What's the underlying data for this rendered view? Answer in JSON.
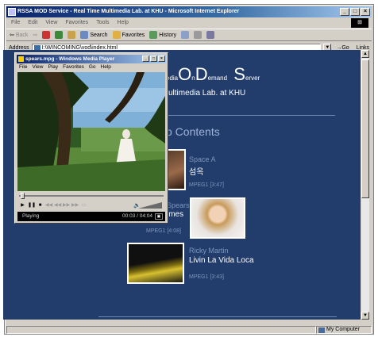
{
  "ie": {
    "title": "RSSA MOD Service - Real Time Multimedia Lab. at KHU - Microsoft Internet Explorer",
    "menu": [
      "File",
      "Edit",
      "View",
      "Favorites",
      "Tools",
      "Help"
    ],
    "toolbar": {
      "back": "Back",
      "search": "Search",
      "favorites": "Favorites",
      "history": "History"
    },
    "address_label": "Address",
    "address_value": "I:\\WINCOMING\\vod\\index.html",
    "go_label": "Go",
    "links_label": "Links",
    "status_zone": "My Computer"
  },
  "page": {
    "title_media": "edia",
    "title_o": "O",
    "title_n": "n",
    "title_d": "D",
    "title_emand": "emand",
    "title_s": "S",
    "title_erver": "erver",
    "subtitle": "ultimedia Lab. at KHU",
    "section": "o Contents",
    "items": [
      {
        "artist": "Space A",
        "title": "섬옥",
        "meta": "MPEG1 [3:47]"
      },
      {
        "artist": "Spears",
        "title": "imes",
        "meta": "MPEG1 [4:08]"
      },
      {
        "artist": "Ricky Martin",
        "title": "Livin La Vida Loca",
        "meta": "MPEG1 [3:43]"
      }
    ]
  },
  "wmp": {
    "title": "spears.mpg - Windows Media Player",
    "menu": [
      "File",
      "View",
      "Play",
      "Favorites",
      "Go",
      "Help"
    ],
    "status": "Playing",
    "time": "00:03 / 04:04",
    "progress_fraction": 0.012
  },
  "colors": {
    "page_bg": "#223d6b",
    "titlebar": "#0a246a"
  }
}
